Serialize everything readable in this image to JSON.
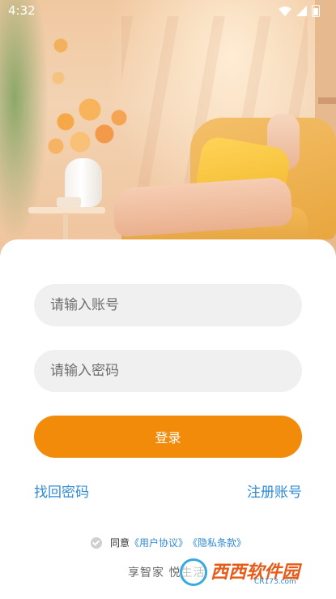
{
  "status_bar": {
    "time": "4:32"
  },
  "login": {
    "account_placeholder": "请输入账号",
    "password_placeholder": "请输入密码",
    "login_button": "登录",
    "forgot_password": "找回密码",
    "register": "注册账号"
  },
  "agreement": {
    "prefix": "同意",
    "user_agreement": "《用户协议》",
    "privacy_policy": "《隐私条款》"
  },
  "slogan": "享智家 悦生活",
  "watermark": {
    "title": "西西软件园",
    "subtitle": "CR173.com"
  },
  "colors": {
    "accent": "#f28a0a",
    "link": "#2f8ad6",
    "input_bg": "#f0f0f0"
  },
  "icons": [
    "wifi-icon",
    "signal-icon",
    "battery-icon",
    "checkbox-icon"
  ]
}
